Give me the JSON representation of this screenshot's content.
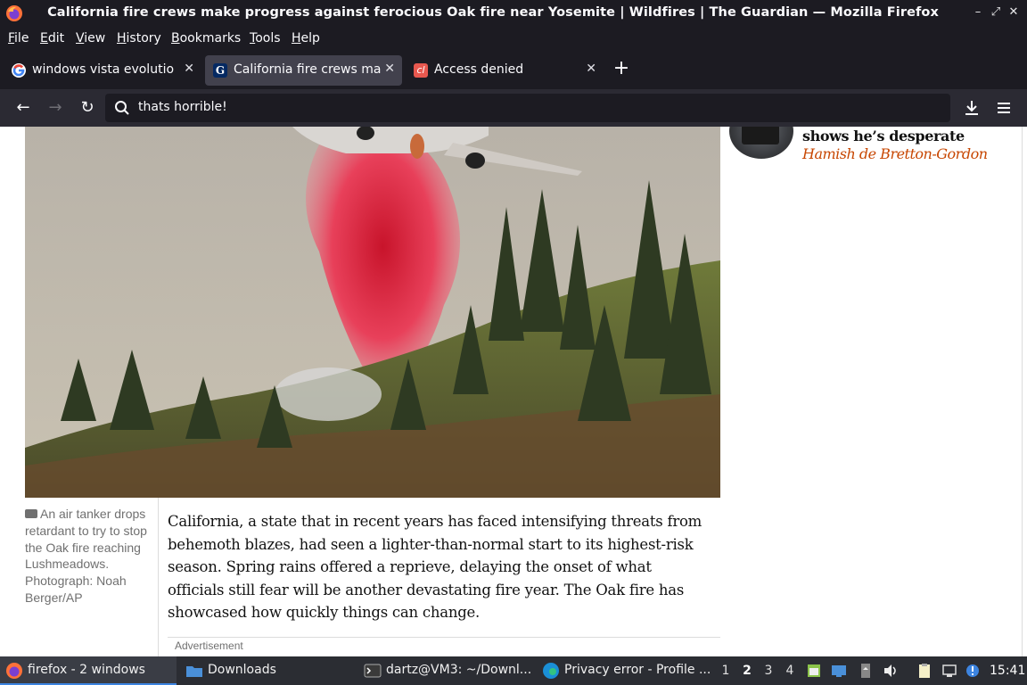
{
  "window": {
    "title": "California fire crews make progress against ferocious Oak fire near Yosemite | Wildfires | The Guardian — Mozilla Firefox"
  },
  "menu": {
    "items": [
      "File",
      "Edit",
      "View",
      "History",
      "Bookmarks",
      "Tools",
      "Help"
    ]
  },
  "tabs": [
    {
      "label": "windows vista evolution",
      "icon": "google-icon",
      "active": false
    },
    {
      "label": "California fire crews make progress",
      "icon": "guardian-icon",
      "active": true
    },
    {
      "label": "Access denied",
      "icon": "cl-icon",
      "active": false
    }
  ],
  "urlbar": {
    "value": "thats horrible!"
  },
  "article": {
    "sidebar_headline": "shows he’s desperate",
    "sidebar_author": "Hamish de Bretton-Gordon",
    "caption": "An air tanker drops retardant to try to stop the Oak fire reaching Lushmeadows. Photograph: Noah Berger/AP",
    "paragraph": "California, a state that in recent years has faced intensifying threats from behemoth blazes, had seen a lighter-than-normal start to its highest-risk season. Spring rains offered a reprieve, delaying the onset of what officials still fear will be another devastating fire year. The Oak fire has showcased how quickly things can change.",
    "ad_label": "Advertisement"
  },
  "taskbar": {
    "items": [
      {
        "label": "firefox - 2 windows",
        "icon": "firefox-icon"
      },
      {
        "label": "Downloads",
        "icon": "folder-icon"
      },
      {
        "label": "dartz@VM3: ~/Downl...",
        "icon": "terminal-icon"
      },
      {
        "label": "Privacy error - Profile ...",
        "icon": "edge-icon"
      }
    ],
    "workspaces": [
      "1",
      "2",
      "3",
      "4"
    ],
    "current_workspace": "2",
    "clock": "15:41"
  }
}
